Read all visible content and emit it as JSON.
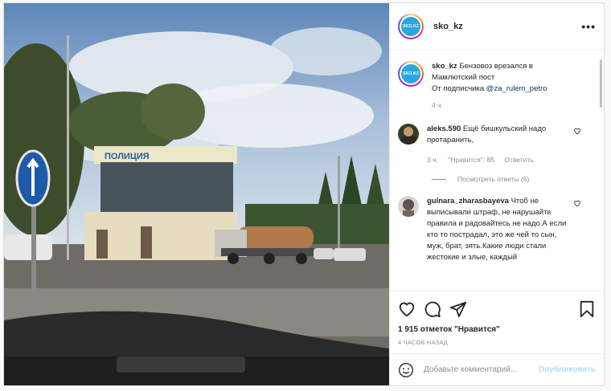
{
  "post": {
    "username": "sko_kz",
    "avatar_text": "SKO.KZ",
    "more_icon": "three-dots-icon",
    "photo": {
      "sign_text": "ПОЛИЦИЯ",
      "description_icon": "photo"
    },
    "caption": {
      "username": "sko_kz",
      "text": "Бензовоз врезался в Мамлютский пост",
      "line2_prefix": "От подписчика",
      "mention": "@za_rulem_petro",
      "time": "4 ч."
    },
    "comments": [
      {
        "username": "aleks.590",
        "text": "Ещё бишкульский надо протаранить,",
        "time": "3 ч.",
        "likes": "\"Нравится\": 85",
        "reply": "Ответить",
        "view_replies": "Посмотреть ответы (6)"
      },
      {
        "username": "gulnara_zharasbayeva",
        "text": "Чтоб не выписывали штраф, не нарушайте правила и радовайтесь не надо.А если кто то пострадал, это же чей то сын, муж, брат, зять.Какие люди стали жестокие и злые, каждый"
      }
    ],
    "likes_count": "1 915 отметок \"Нравится\"",
    "timestamp": "4 ЧАСОВ НАЗАД",
    "add_comment_placeholder": "Добавьте комментарий...",
    "publish_label": "Опубликовать"
  },
  "colors": {
    "accent_blue": "#0095f6",
    "publish_disabled": "#b2dffc",
    "mention": "#00376b",
    "muted": "#8e8e8e"
  }
}
